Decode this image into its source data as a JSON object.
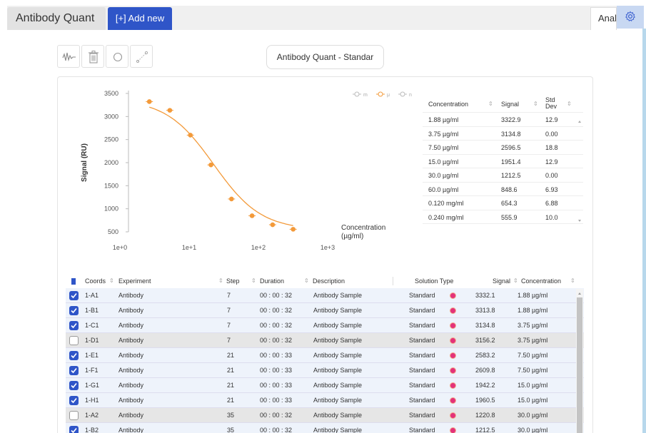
{
  "tabs": {
    "title": "Antibody Quant",
    "add_new": "[+] Add new",
    "right_tab": "Anal"
  },
  "icons": {
    "toolbar": [
      "waveform-icon",
      "trash-icon",
      "circle-icon",
      "fit-line-icon"
    ],
    "settings": "gear-icon"
  },
  "chart_selector": "Antibody Quant - Standar",
  "chart_data": {
    "type": "scatter",
    "x_scale": "log",
    "xlabel": "Concentration (µg/ml)",
    "ylabel": "Signal (RU)",
    "x_ticks": [
      "1e+0",
      "1e+1",
      "1e+2",
      "1e+3"
    ],
    "y_ticks": [
      500,
      1000,
      1500,
      2000,
      2500,
      3000,
      3500
    ],
    "ylim": [
      500,
      3500
    ],
    "legend": [
      "m",
      "μ",
      "n"
    ],
    "legend_placement": "top-right",
    "series_color": "#f39a3a",
    "points": [
      {
        "x": 1.88,
        "y": 3322.9
      },
      {
        "x": 3.75,
        "y": 3134.8
      },
      {
        "x": 7.5,
        "y": 2596.5
      },
      {
        "x": 15.0,
        "y": 1951.4
      },
      {
        "x": 30.0,
        "y": 1212.5
      },
      {
        "x": 60.0,
        "y": 848.6
      },
      {
        "x": 120.0,
        "y": 654.3
      },
      {
        "x": 240.0,
        "y": 555.9
      }
    ]
  },
  "std_table": {
    "headers": [
      "Concentration",
      "Signal",
      "Std Dev"
    ],
    "rows": [
      [
        "1.88 µg/ml",
        "3322.9",
        "12.9"
      ],
      [
        "3.75 µg/ml",
        "3134.8",
        "0.00"
      ],
      [
        "7.50 µg/ml",
        "2596.5",
        "18.8"
      ],
      [
        "15.0 µg/ml",
        "1951.4",
        "12.9"
      ],
      [
        "30.0 µg/ml",
        "1212.5",
        "0.00"
      ],
      [
        "60.0 µg/ml",
        "848.6",
        "6.93"
      ],
      [
        "0.120 mg/ml",
        "654.3",
        "6.88"
      ],
      [
        "0.240 mg/ml",
        "555.9",
        "10.0"
      ]
    ]
  },
  "data_table": {
    "headers": [
      "Coords",
      "Experiment",
      "Step",
      "Duration",
      "Description",
      "Solution Type",
      "Signal",
      "Concentration"
    ],
    "rows": [
      {
        "checked": true,
        "coords": "1-A1",
        "experiment": "Antibody",
        "step": "7",
        "duration": "00 : 00 : 32",
        "description": "Antibody Sample",
        "type": "Standard",
        "signal": "3332.1",
        "conc": "1.88",
        "unit": "µg/ml"
      },
      {
        "checked": true,
        "coords": "1-B1",
        "experiment": "Antibody",
        "step": "7",
        "duration": "00 : 00 : 32",
        "description": "Antibody Sample",
        "type": "Standard",
        "signal": "3313.8",
        "conc": "1.88",
        "unit": "µg/ml"
      },
      {
        "checked": true,
        "coords": "1-C1",
        "experiment": "Antibody",
        "step": "7",
        "duration": "00 : 00 : 32",
        "description": "Antibody Sample",
        "type": "Standard",
        "signal": "3134.8",
        "conc": "3.75",
        "unit": "µg/ml"
      },
      {
        "checked": false,
        "coords": "1-D1",
        "experiment": "Antibody",
        "step": "7",
        "duration": "00 : 00 : 32",
        "description": "Antibody Sample",
        "type": "Standard",
        "signal": "3156.2",
        "conc": "3.75",
        "unit": "µg/ml"
      },
      {
        "checked": true,
        "coords": "1-E1",
        "experiment": "Antibody",
        "step": "21",
        "duration": "00 : 00 : 33",
        "description": "Antibody Sample",
        "type": "Standard",
        "signal": "2583.2",
        "conc": "7.50",
        "unit": "µg/ml"
      },
      {
        "checked": true,
        "coords": "1-F1",
        "experiment": "Antibody",
        "step": "21",
        "duration": "00 : 00 : 33",
        "description": "Antibody Sample",
        "type": "Standard",
        "signal": "2609.8",
        "conc": "7.50",
        "unit": "µg/ml"
      },
      {
        "checked": true,
        "coords": "1-G1",
        "experiment": "Antibody",
        "step": "21",
        "duration": "00 : 00 : 33",
        "description": "Antibody Sample",
        "type": "Standard",
        "signal": "1942.2",
        "conc": "15.0",
        "unit": "µg/ml"
      },
      {
        "checked": true,
        "coords": "1-H1",
        "experiment": "Antibody",
        "step": "21",
        "duration": "00 : 00 : 33",
        "description": "Antibody Sample",
        "type": "Standard",
        "signal": "1960.5",
        "conc": "15.0",
        "unit": "µg/ml"
      },
      {
        "checked": false,
        "coords": "1-A2",
        "experiment": "Antibody",
        "step": "35",
        "duration": "00 : 00 : 32",
        "description": "Antibody Sample",
        "type": "Standard",
        "signal": "1220.8",
        "conc": "30.0",
        "unit": "µg/ml"
      },
      {
        "checked": true,
        "coords": "1-B2",
        "experiment": "Antibody",
        "step": "35",
        "duration": "00 : 00 : 32",
        "description": "Antibody Sample",
        "type": "Standard",
        "signal": "1212.5",
        "conc": "30.0",
        "unit": "µg/ml"
      }
    ]
  },
  "colors": {
    "accent": "#2f55c8",
    "curve": "#f39a3a",
    "dot": "#e3327a"
  }
}
